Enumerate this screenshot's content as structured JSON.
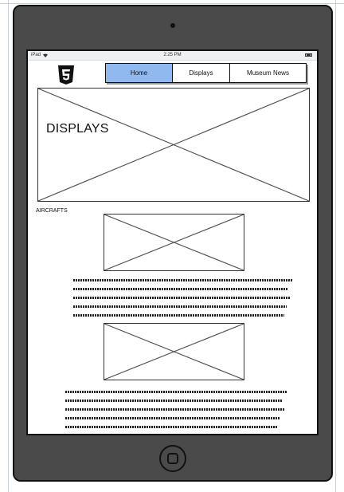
{
  "status_bar": {
    "carrier": "iPad",
    "time": "2:25 PM"
  },
  "nav": {
    "items": [
      {
        "label": "Home",
        "active": true
      },
      {
        "label": "Displays",
        "active": false
      },
      {
        "label": "Museum News",
        "active": false
      }
    ]
  },
  "hero": {
    "title": "DISPLAYS"
  },
  "section": {
    "label": "AIRCRAFTS"
  },
  "colors": {
    "device_frame": "#4a4a4a",
    "nav_active": "#8fb9ef",
    "logo": "#111111"
  },
  "icons": {
    "logo": "html5-logo-icon",
    "wifi": "wifi-icon",
    "battery": "battery-icon",
    "home_button": "home-button-icon"
  }
}
